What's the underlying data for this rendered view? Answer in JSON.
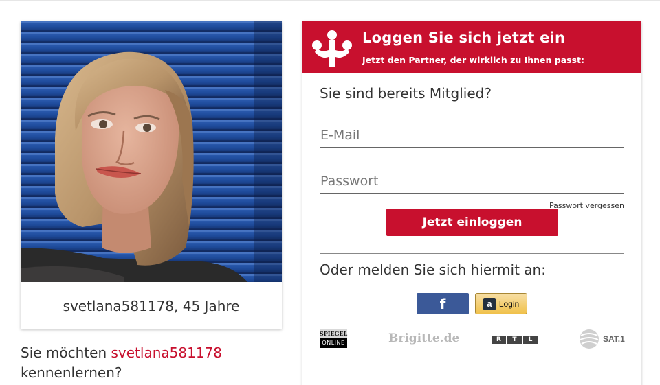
{
  "profile": {
    "caption": "svetlana581178, 45 Jahre",
    "meet_prefix": "Sie möchten",
    "meet_name": "svetlana581178",
    "meet_suffix": "kennenlernen?"
  },
  "login": {
    "title": "Loggen Sie sich jetzt ein",
    "subtitle": "Jetzt den Partner, der wirklich zu Ihnen passt:",
    "member_question": "Sie sind bereits Mitglied?",
    "email_placeholder": "E-Mail",
    "password_placeholder": "Passwort",
    "forgot_password": "Passwort vergessen",
    "submit_label": "Jetzt einloggen",
    "social_question": "Oder melden Sie sich hiermit an:",
    "facebook_label": "f",
    "amazon_label": "Login"
  },
  "partners": {
    "spiegel_top": "SPIEGEL",
    "spiegel_bottom": "ONLINE",
    "brigitte": "Brigitte.de",
    "rtl": [
      "R",
      "T",
      "L"
    ],
    "sat1": "SAT.1"
  },
  "icons": {
    "logo": "paw-logo-icon",
    "facebook": "facebook-icon",
    "amazon": "amazon-icon"
  },
  "colors": {
    "brand_red": "#c8102e",
    "facebook_blue": "#3b5998",
    "amazon_gold": "#f0c14b"
  }
}
